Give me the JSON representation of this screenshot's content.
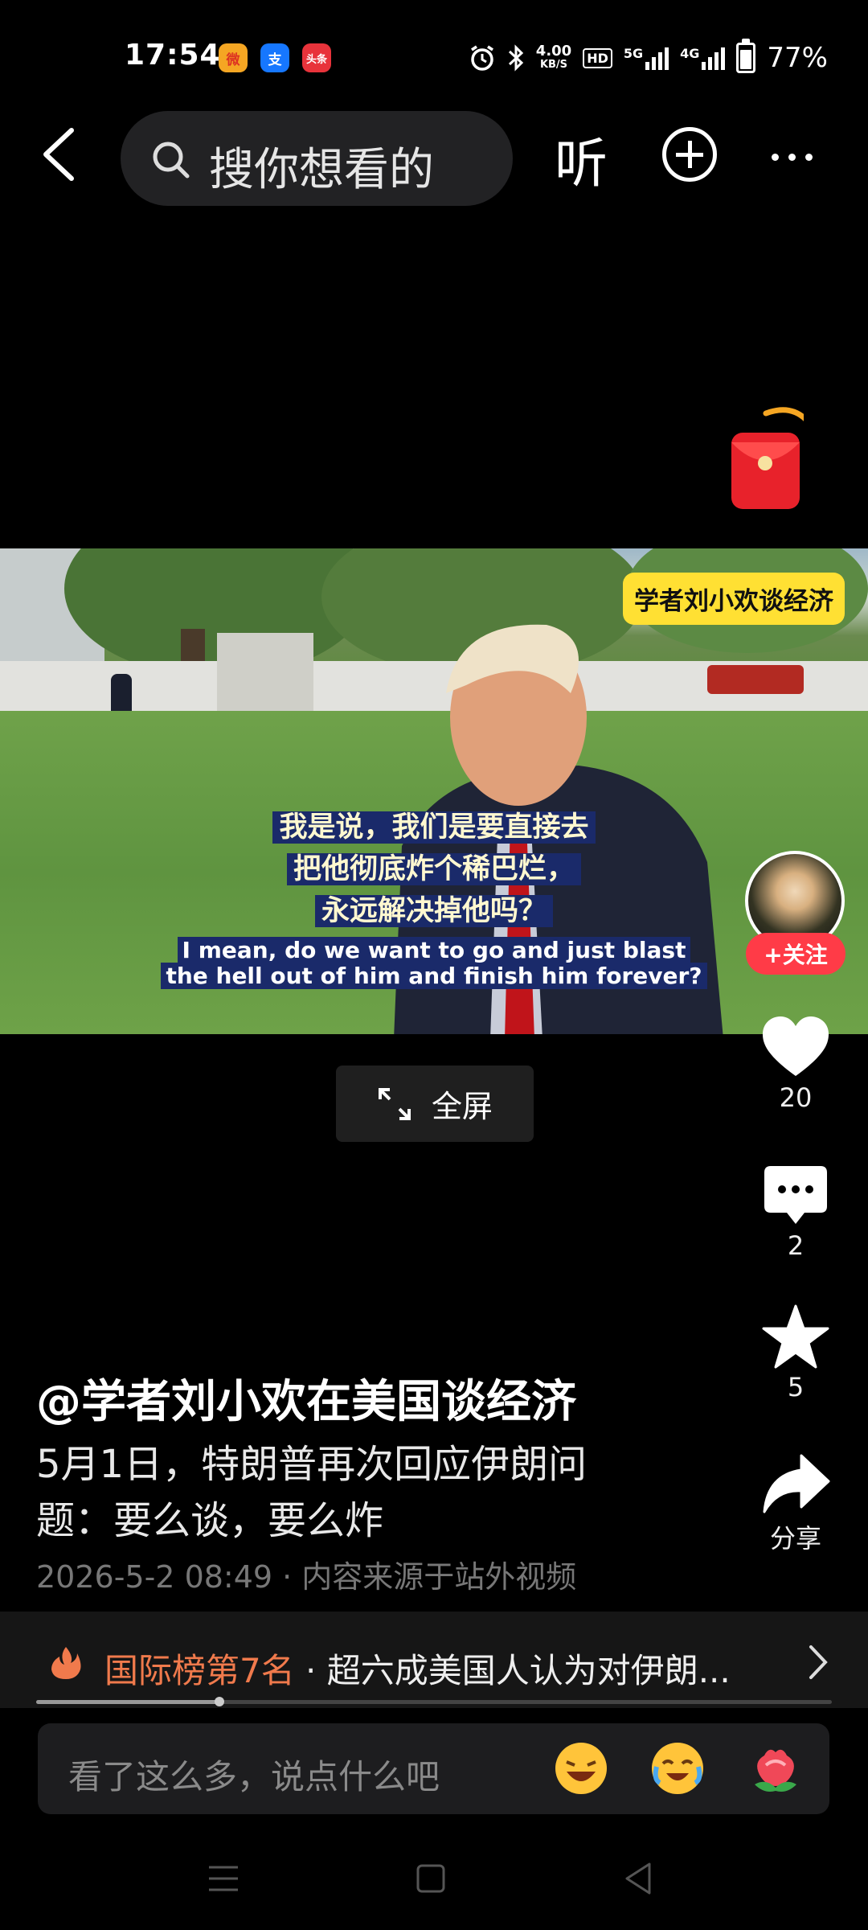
{
  "status_bar": {
    "time": "17:54",
    "apps": [
      "微",
      "支",
      "头条"
    ],
    "net_speed_top": "4.00",
    "net_speed_bottom": "KB/S",
    "hd": "HD",
    "sig1": "5G",
    "sig2": "4G",
    "battery": "77%"
  },
  "top_bar": {
    "search_placeholder": "搜你想看的",
    "listen_label": "听"
  },
  "video": {
    "channel_tag": "学者刘小欢谈经济",
    "subtitle_cn": [
      "我是说，我们是要直接去",
      "把他彻底炸个稀巴烂，",
      "永远解决掉他吗？"
    ],
    "subtitle_en": [
      "I mean, do we want to go and just blast",
      "the hell out of him and finish him forever?"
    ],
    "fullscreen_label": "全屏"
  },
  "rail": {
    "follow_label": "+关注",
    "likes": "20",
    "comments": "2",
    "favorites": "5",
    "share_label": "分享"
  },
  "post": {
    "author": "@学者刘小欢在美国谈经济",
    "description": "5月1日，特朗普再次回应伊朗问题：要么谈，要么炸",
    "meta": "2026-5-2 08:49 · 内容来源于站外视频"
  },
  "trending": {
    "rank_label": "国际榜第7名",
    "text": "· 超六成美国人认为对伊朗...",
    "progress": 0.23
  },
  "comment": {
    "placeholder": "看了这么多，说点什么吧"
  },
  "colors": {
    "accent_red": "#ff3b47",
    "trend_orange": "#f07a4c",
    "tag_yellow": "#ffe033"
  }
}
